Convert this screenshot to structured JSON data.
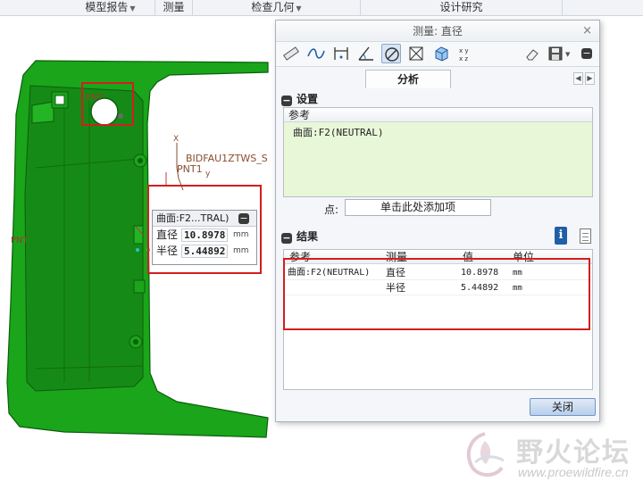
{
  "ribbon": {
    "tabs": [
      {
        "label": "模型报告",
        "has_caret": true
      },
      {
        "label": "测量",
        "has_caret": false
      },
      {
        "label": "检查几何",
        "has_caret": true
      },
      {
        "label": "设计研究",
        "has_caret": false
      }
    ]
  },
  "viewport": {
    "labels": {
      "pnt_top": "PNT",
      "datum_long": "BIDFAU1ZTWS_S",
      "pnt1": "PNT1",
      "pnt_left": "PNT",
      "axis_x": "X",
      "axis_y": "y"
    },
    "callout": {
      "title": "曲面:F2...TRAL)",
      "rows": [
        {
          "label": "直径",
          "value": "10.8978",
          "unit": "mm"
        },
        {
          "label": "半径",
          "value": "5.44892",
          "unit": "mm"
        }
      ]
    }
  },
  "dialog": {
    "title": "测量: 直径",
    "close_symbol": "×",
    "tab": "分析",
    "tools": [
      "ruler-icon",
      "curve-icon",
      "distance-icon",
      "angle-icon",
      "diameter-icon",
      "area-icon",
      "volume-icon",
      "transform-icon"
    ],
    "setup": {
      "header": "设置",
      "ref_column": "参考",
      "ref_value": "曲面:F2(NEUTRAL)",
      "point_label": "点:",
      "point_placeholder": "单击此处添加项"
    },
    "results": {
      "header": "结果",
      "columns": [
        "参考",
        "测量",
        "值",
        "单位"
      ],
      "rows": [
        {
          "ref": "曲面:F2(NEUTRAL)",
          "measure": "直径",
          "value": "10.8978",
          "unit": "mm"
        },
        {
          "ref": "",
          "measure": "半径",
          "value": "5.44892",
          "unit": "mm"
        }
      ]
    },
    "close_button": "关闭"
  },
  "watermark": {
    "name": "野火论坛",
    "url": "www.proewildfire.cn"
  },
  "colors": {
    "model_green": "#1aa51a",
    "highlight_red": "#d21e1e",
    "ref_bg": "#e9f7d9",
    "accent_blue": "#1f5fa8"
  }
}
